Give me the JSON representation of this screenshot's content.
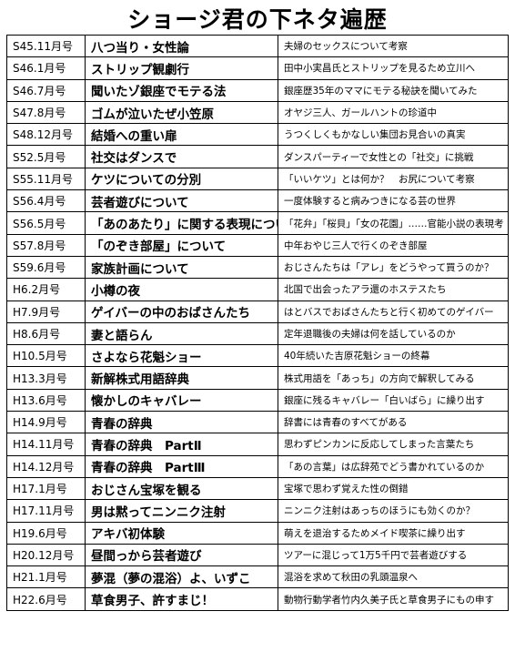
{
  "title": "ショージ君の下ネタ遍歴",
  "rows": [
    {
      "issue": "S45.11月号",
      "topic": "八つ当り・女性論",
      "desc": "夫婦のセックスについて考察"
    },
    {
      "issue": "S46.1月号",
      "topic": "ストリップ観劇行",
      "desc": "田中小実昌氏とストリップを見るため立川へ"
    },
    {
      "issue": "S46.7月号",
      "topic": "聞いたゾ銀座でモテる法",
      "desc": "銀座歴35年のママにモテる秘訣を聞いてみた"
    },
    {
      "issue": "S47.8月号",
      "topic": "ゴムが泣いたぜ小笠原",
      "desc": "オヤジ三人、ガールハントの珍道中"
    },
    {
      "issue": "S48.12月号",
      "topic": "結婚への重い扉",
      "desc": "うつくしくもかなしい集団お見合いの真実"
    },
    {
      "issue": "S52.5月号",
      "topic": "社交はダンスで",
      "desc": "ダンスパーティーで女性との「社交」に挑戦"
    },
    {
      "issue": "S55.11月号",
      "topic": "ケツについての分別",
      "desc": "「いいケツ」とは何か？　お尻について考察"
    },
    {
      "issue": "S56.4月号",
      "topic": "芸者遊びについて",
      "desc": "一度体験すると病みつきになる芸の世界"
    },
    {
      "issue": "S56.5月号",
      "topic": "「あのあたり」に関する表現について",
      "desc": "「花弁」「桜貝」「女の花園」……官能小説の表現考"
    },
    {
      "issue": "S57.8月号",
      "topic": "「のぞき部屋」について",
      "desc": "中年おやじ三人で行くのぞき部屋"
    },
    {
      "issue": "S59.6月号",
      "topic": "家族計画について",
      "desc": "おじさんたちは「アレ」をどうやって買うのか？"
    },
    {
      "issue": "H6.2月号",
      "topic": "小樽の夜",
      "desc": "北国で出会ったアラ還のホステスたち"
    },
    {
      "issue": "H7.9月号",
      "topic": "ゲイバーの中のおばさんたち",
      "desc": "はとバスでおばさんたちと行く初めてのゲイバー"
    },
    {
      "issue": "H8.6月号",
      "topic": "妻と語らん",
      "desc": "定年退職後の夫婦は何を話しているのか"
    },
    {
      "issue": "H10.5月号",
      "topic": "さよなら花魁ショー",
      "desc": "40年続いた吉原花魁ショーの終幕"
    },
    {
      "issue": "H13.3月号",
      "topic": "新解株式用語辞典",
      "desc": "株式用語を「あっち」の方向で解釈してみる"
    },
    {
      "issue": "H13.6月号",
      "topic": "懐かしのキャバレー",
      "desc": "銀座に残るキャバレー「白いばら」に繰り出す"
    },
    {
      "issue": "H14.9月号",
      "topic": "青春の辞典",
      "desc": "辞書には青春のすべてがある"
    },
    {
      "issue": "H14.11月号",
      "topic": "青春の辞典　PartⅡ",
      "desc": "思わずピンカンに反応してしまった言葉たち"
    },
    {
      "issue": "H14.12月号",
      "topic": "青春の辞典　PartⅢ",
      "desc": "「あの言葉」は広辞苑でどう書かれているのか"
    },
    {
      "issue": "H17.1月号",
      "topic": "おじさん宝塚を観る",
      "desc": "宝塚で思わず覚えた性の倒錯"
    },
    {
      "issue": "H17.11月号",
      "topic": "男は黙ってニンニク注射",
      "desc": "ニンニク注射はあっちのほうにも効くのか？"
    },
    {
      "issue": "H19.6月号",
      "topic": "アキバ初体験",
      "desc": "萌えを退治するためメイド喫茶に繰り出す"
    },
    {
      "issue": "H20.12月号",
      "topic": "昼間っから芸者遊び",
      "desc": "ツアーに混じって1万5千円で芸者遊びする"
    },
    {
      "issue": "H21.1月号",
      "topic": "夢混（夢の混浴）よ、いずこ",
      "desc": "混浴を求めて秋田の乳頭温泉へ"
    },
    {
      "issue": "H22.6月号",
      "topic": "草食男子、許すまじ！",
      "desc": "動物行動学者竹内久美子氏と草食男子にもの申す"
    }
  ]
}
